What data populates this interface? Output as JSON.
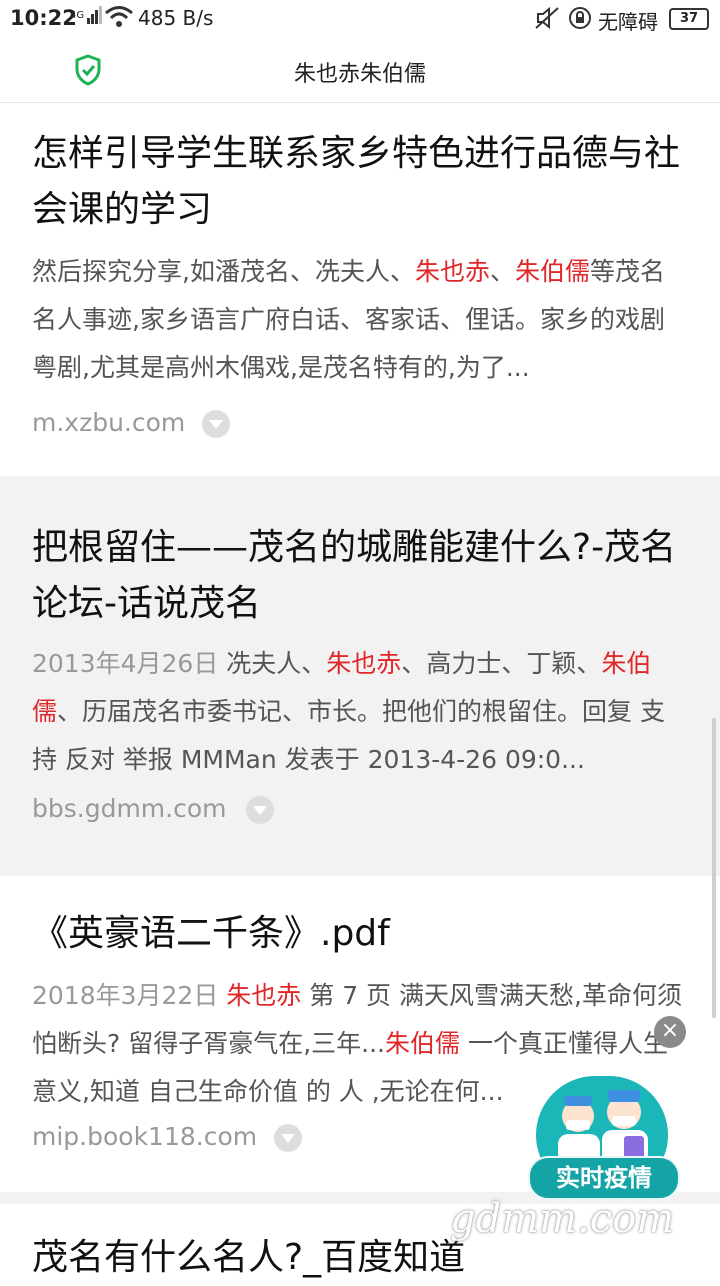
{
  "status_bar": {
    "time": "10:22",
    "network": "4G",
    "speed": "485 B/s",
    "accessibility": "无障碍",
    "battery": "37"
  },
  "header": {
    "title": "朱也赤朱伯儒"
  },
  "results": [
    {
      "title": "怎样引导学生联系家乡特色进行品德与社会课的学习",
      "date": "",
      "snippet_parts": [
        "然后探究分享,如潘茂名、冼夫人、",
        "朱也赤",
        "、",
        "朱伯儒",
        "等茂名名人事迹,家乡语言广府白话、客家话、俚话。家乡的戏剧粤剧,尤其是高州木偶戏,是茂名特有的,为了..."
      ],
      "source": "m.xzbu.com"
    },
    {
      "title": "把根留住——茂名的城雕能建什么?-茂名论坛-话说茂名",
      "date": "2013年4月26日",
      "snippet_parts": [
        " 冼夫人、",
        "朱也赤",
        "、高力士、丁颖、",
        "朱伯儒",
        "、历届茂名市委书记、市长。把他们的根留住。回复 支持 反对 举报 MMMan 发表于 2013-4-26 09:0..."
      ],
      "source": "bbs.gdmm.com"
    },
    {
      "title": "《英豪语二千条》.pdf",
      "date": "2018年3月22日",
      "snippet_parts": [
        " ",
        "朱也赤",
        " 第 7 页 满天风雪满天愁,革命何须怕断头? 留得子胥豪气在,三年...",
        "朱伯儒",
        " 一个真正懂得人生意义,知道 自己生命价值 的 人 ,无论在何..."
      ],
      "source": "mip.book118.com"
    },
    {
      "title": "茂名有什么名人?_百度知道"
    }
  ],
  "floating_badge": {
    "label": "实时疫情",
    "close": "×"
  },
  "watermark": "gdmm.com",
  "colors": {
    "highlight": "#e0282a",
    "shield": "#1db354",
    "badge": "#1bb6b8"
  }
}
